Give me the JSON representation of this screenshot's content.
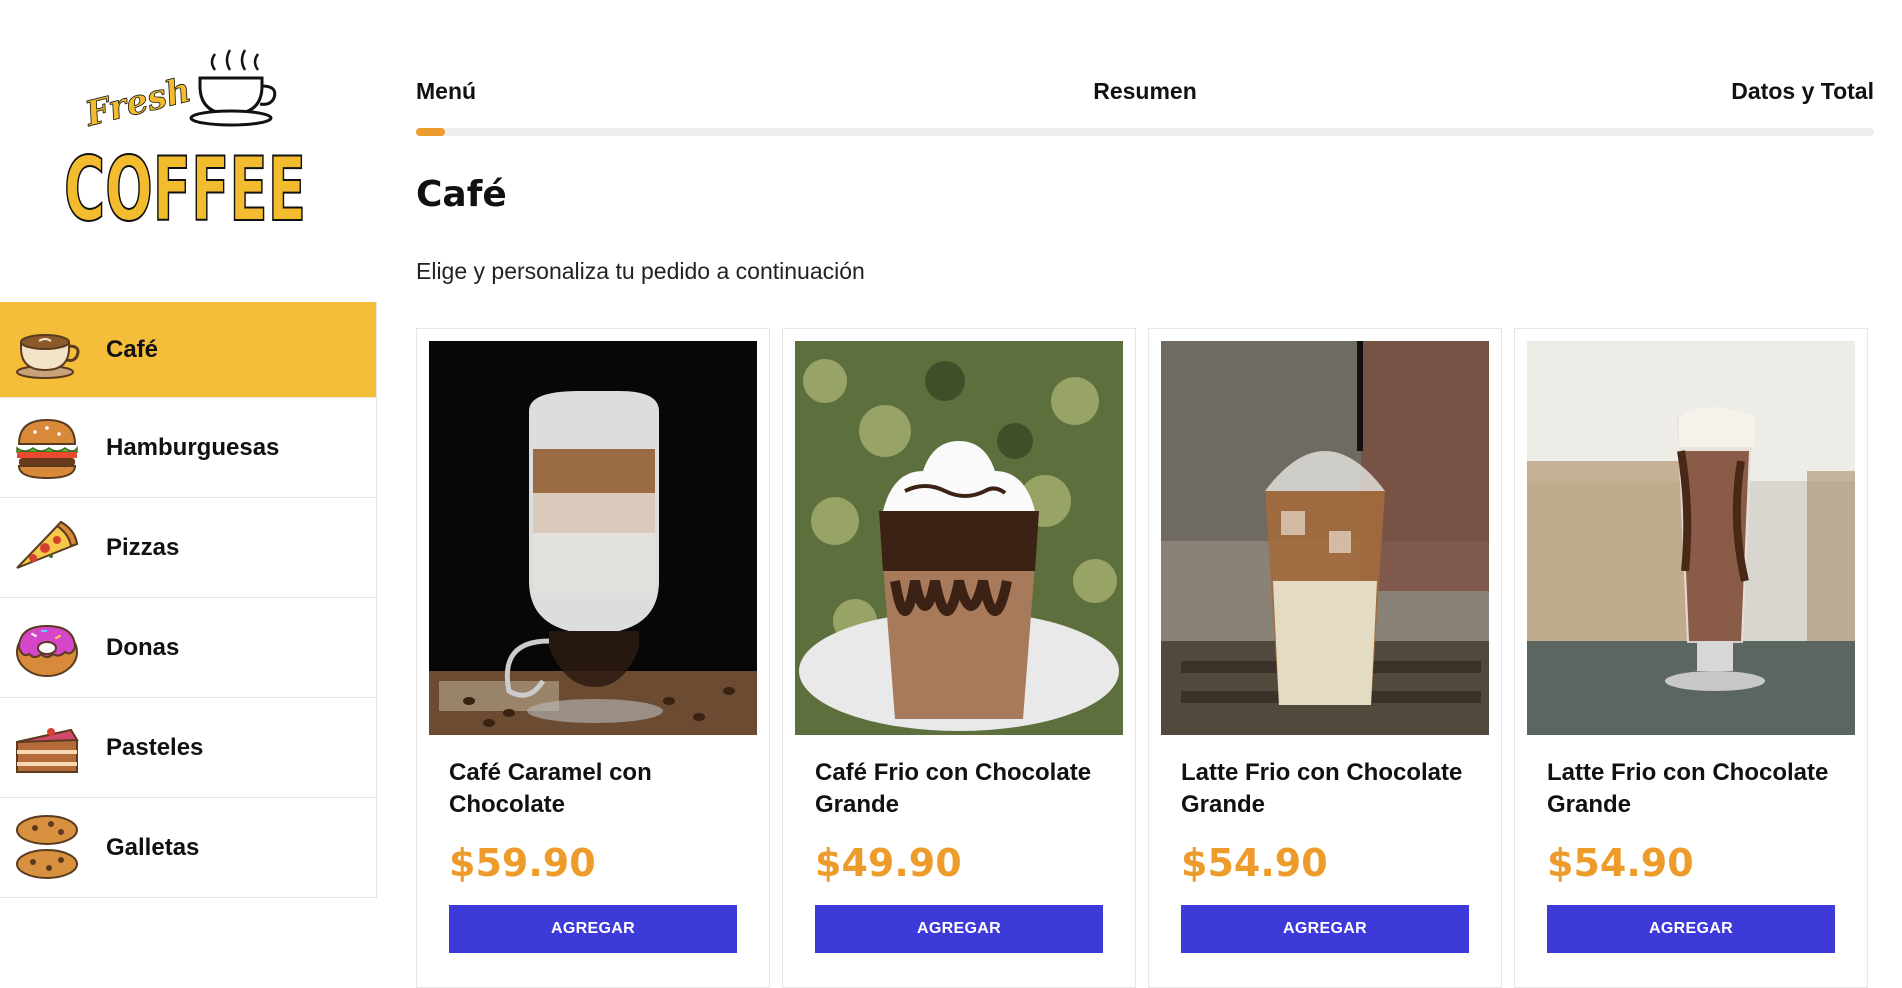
{
  "logo": {
    "top_text": "Fresh",
    "main_text": "COFFEE"
  },
  "sidebar": {
    "active": 0,
    "items": [
      {
        "label": "Café",
        "icon": "coffee-cup-icon"
      },
      {
        "label": "Hamburguesas",
        "icon": "burger-icon"
      },
      {
        "label": "Pizzas",
        "icon": "pizza-icon"
      },
      {
        "label": "Donas",
        "icon": "donut-icon"
      },
      {
        "label": "Pasteles",
        "icon": "cake-icon"
      },
      {
        "label": "Galletas",
        "icon": "cookie-icon"
      }
    ]
  },
  "steps": {
    "menu": "Menú",
    "resumen": "Resumen",
    "datos": "Datos y Total",
    "progress": 0.02
  },
  "main": {
    "title": "Café",
    "subtitle": "Elige y personaliza tu pedido a continuación"
  },
  "products": [
    {
      "name": "Café Caramel con Chocolate",
      "price": "$59.90",
      "button": "AGREGAR"
    },
    {
      "name": "Café Frio con Chocolate Grande",
      "price": "$49.90",
      "button": "AGREGAR"
    },
    {
      "name": "Latte Frio con Chocolate Grande",
      "price": "$54.90",
      "button": "AGREGAR"
    },
    {
      "name": "Latte Frio con Chocolate Grande",
      "price": "$54.90",
      "button": "AGREGAR"
    }
  ],
  "colors": {
    "accent": "#f4be3a",
    "price": "#ed9c2c",
    "button": "#3e3ad9"
  }
}
